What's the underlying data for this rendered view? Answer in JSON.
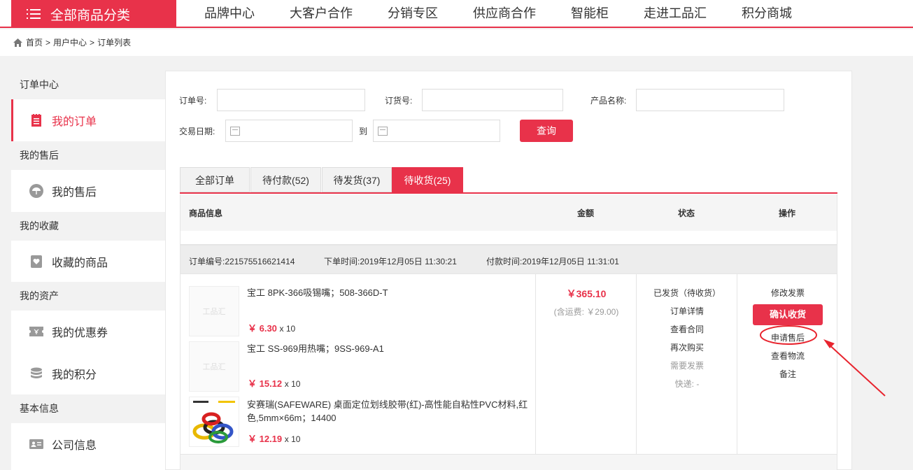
{
  "topnav": {
    "all_categories": "全部商品分类",
    "items": [
      "品牌中心",
      "大客户合作",
      "分销专区",
      "供应商合作",
      "智能柜",
      "走进工品汇",
      "积分商城"
    ]
  },
  "breadcrumb": {
    "home": "首页",
    "sep": ">",
    "level1": "用户中心",
    "level2": "订单列表"
  },
  "sidebar": {
    "groups": [
      "订单中心",
      "我的售后",
      "我的收藏",
      "我的资产",
      "基本信息"
    ],
    "items": [
      {
        "label": "我的订单",
        "icon": "order-icon"
      },
      {
        "label": "我的售后",
        "icon": "umbrella-icon"
      },
      {
        "label": "收藏的商品",
        "icon": "heart-icon"
      },
      {
        "label": "我的优惠券",
        "icon": "coupon-icon"
      },
      {
        "label": "我的积分",
        "icon": "coins-icon"
      },
      {
        "label": "公司信息",
        "icon": "id-card-icon"
      }
    ]
  },
  "filters": {
    "order_no_label": "订单号:",
    "order_no_value": "",
    "purchase_no_label": "订货号:",
    "purchase_no_value": "",
    "product_name_label": "产品名称:",
    "product_name_value": "",
    "date_label": "交易日期:",
    "date_to": "到",
    "query_button": "查询"
  },
  "tabs": [
    {
      "label": "全部订单",
      "active": false
    },
    {
      "label": "待付款(52)",
      "active": false
    },
    {
      "label": "待发货(37)",
      "active": false
    },
    {
      "label": "待收货(25)",
      "active": true
    }
  ],
  "table_header": {
    "product_info": "商品信息",
    "amount": "金额",
    "status": "状态",
    "actions": "操作"
  },
  "order": {
    "order_no_label": "订单编号:",
    "order_no": "221575516621414",
    "order_time_label": "下单时间:",
    "order_time": "2019年12月05日 11:30:21",
    "pay_time_label": "付款时间:",
    "pay_time": "2019年12月05日 11:31:01",
    "products": [
      {
        "name": "宝工 8PK-366吸锡嘴；508-366D-T",
        "price": "￥ 6.30",
        "qty": "x 10",
        "thumb": "工品汇"
      },
      {
        "name": "宝工 SS-969用热嘴；9SS-969-A1",
        "price": "￥ 15.12",
        "qty": "x 10",
        "thumb": "工品汇"
      },
      {
        "name": "安赛瑞(SAFEWARE) 桌面定位划线胶带(红)-高性能自粘性PVC材料,红色,5mm×66m；14400",
        "price": "￥ 12.19",
        "qty": "x 10",
        "thumb": ""
      }
    ],
    "total": "￥365.10",
    "shipping": "(含运费: ￥29.00)",
    "status_lines": [
      "已发货（待收货）",
      "订单详情",
      "查看合同",
      "再次购买"
    ],
    "status_muted": [
      "需要发票",
      "快递: -"
    ],
    "actions": {
      "modify_invoice": "修改发票",
      "confirm_receipt": "确认收货",
      "apply_aftersale": "申请售后",
      "view_logistics": "查看物流",
      "remark": "备注"
    }
  },
  "colors": {
    "accent": "#e8324a",
    "annotation": "#e8242e"
  }
}
